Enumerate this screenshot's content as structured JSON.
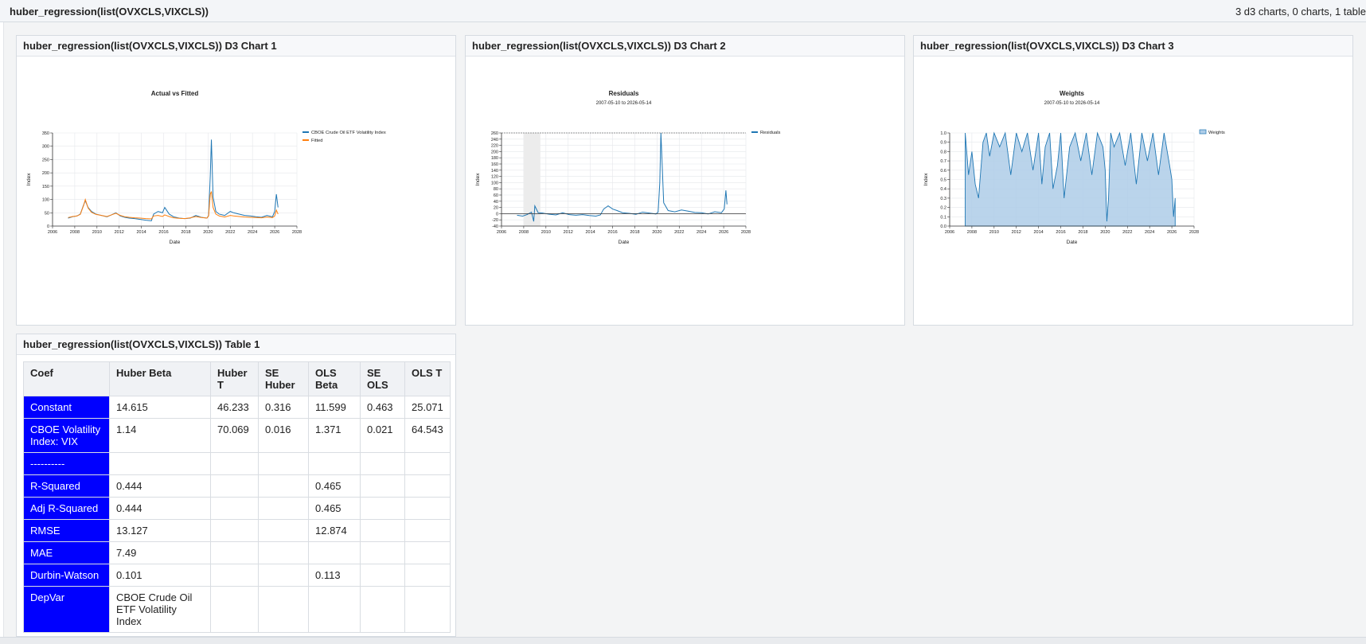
{
  "header": {
    "title": "huber_regression(list(OVXCLS,VIXCLS))",
    "summary": "3 d3 charts, 0 charts, 1 table"
  },
  "colors": {
    "series_blue": "#1f77b4",
    "series_orange": "#ff7f0e",
    "rowhead_blue": "#0000ff",
    "weights_fill": "#aecde8"
  },
  "panels": {
    "chart1_title": "huber_regression(list(OVXCLS,VIXCLS)) D3 Chart 1",
    "chart2_title": "huber_regression(list(OVXCLS,VIXCLS)) D3 Chart 2",
    "chart3_title": "huber_regression(list(OVXCLS,VIXCLS)) D3 Chart 3",
    "table_title": "huber_regression(list(OVXCLS,VIXCLS)) Table 1"
  },
  "chart_data": [
    {
      "type": "line",
      "title": "Actual vs Fitted",
      "subtitle": "",
      "xlabel": "Date",
      "ylabel": "Index",
      "xlim": [
        2006,
        2028
      ],
      "ylim": [
        0,
        350
      ],
      "xticks": [
        "2006",
        "2008",
        "2010",
        "2012",
        "2014",
        "2016",
        "2018",
        "2020",
        "2022",
        "2024",
        "2026",
        "2028"
      ],
      "yticks": [
        0,
        50,
        100,
        150,
        200,
        250,
        300,
        350
      ],
      "legend": "top-right",
      "grid": true,
      "x": [
        2007.4,
        2007.8,
        2008.2,
        2008.5,
        2008.8,
        2008.95,
        2009.2,
        2009.5,
        2009.9,
        2010.4,
        2010.9,
        2011.3,
        2011.7,
        2012.1,
        2012.5,
        2012.9,
        2013.4,
        2013.9,
        2014.4,
        2014.9,
        2015.1,
        2015.5,
        2015.9,
        2016.1,
        2016.5,
        2016.9,
        2017.4,
        2017.9,
        2018.4,
        2018.9,
        2019.4,
        2019.9,
        2020.05,
        2020.2,
        2020.3,
        2020.45,
        2020.7,
        2021.0,
        2021.5,
        2022.0,
        2022.3,
        2022.8,
        2023.3,
        2023.8,
        2024.3,
        2024.8,
        2025.3,
        2025.8,
        2026.0,
        2026.15,
        2026.3
      ],
      "series": [
        {
          "name": "CBOE Crude Oil ETF Volatility Index",
          "values": [
            30,
            35,
            38,
            45,
            80,
            95,
            70,
            55,
            45,
            40,
            35,
            42,
            50,
            38,
            33,
            30,
            28,
            25,
            22,
            20,
            45,
            55,
            50,
            70,
            45,
            35,
            30,
            28,
            30,
            40,
            33,
            30,
            40,
            190,
            325,
            110,
            55,
            45,
            40,
            55,
            50,
            45,
            40,
            38,
            35,
            33,
            40,
            35,
            55,
            120,
            70
          ]
        },
        {
          "name": "Fitted",
          "values": [
            32,
            36,
            38,
            44,
            78,
            100,
            68,
            52,
            44,
            40,
            36,
            42,
            48,
            40,
            35,
            33,
            31,
            30,
            28,
            27,
            38,
            40,
            36,
            42,
            36,
            31,
            29,
            28,
            31,
            36,
            32,
            30,
            38,
            120,
            130,
            70,
            45,
            38,
            34,
            40,
            38,
            36,
            34,
            33,
            32,
            31,
            34,
            32,
            38,
            60,
            45
          ]
        }
      ]
    },
    {
      "type": "line",
      "title": "Residuals",
      "subtitle": "2007-05-10 to 2026-05-14",
      "xlabel": "Date",
      "ylabel": "Index",
      "xlim": [
        2006,
        2028
      ],
      "ylim": [
        -40,
        260
      ],
      "xticks": [
        "2006",
        "2008",
        "2010",
        "2012",
        "2014",
        "2016",
        "2018",
        "2020",
        "2022",
        "2024",
        "2026",
        "2028"
      ],
      "yticks": [
        -40,
        -20,
        0,
        20,
        40,
        60,
        80,
        100,
        120,
        140,
        160,
        180,
        200,
        220,
        240,
        260
      ],
      "shaded_region": [
        2008.0,
        2009.5
      ],
      "legend": "top-right",
      "grid": true,
      "x": [
        2007.4,
        2007.9,
        2008.3,
        2008.7,
        2008.9,
        2009.0,
        2009.3,
        2009.7,
        2010.3,
        2010.9,
        2011.5,
        2012.1,
        2012.7,
        2013.3,
        2013.9,
        2014.5,
        2014.9,
        2015.2,
        2015.6,
        2016.0,
        2016.4,
        2016.9,
        2017.5,
        2018.1,
        2018.7,
        2019.3,
        2019.9,
        2020.1,
        2020.25,
        2020.35,
        2020.6,
        2021.0,
        2021.6,
        2022.2,
        2022.8,
        2023.4,
        2024.0,
        2024.6,
        2025.2,
        2025.8,
        2026.05,
        2026.2,
        2026.3
      ],
      "series": [
        {
          "name": "Residuals",
          "values": [
            -5,
            -8,
            -3,
            5,
            -25,
            25,
            3,
            2,
            -2,
            -4,
            3,
            -3,
            -5,
            -3,
            -6,
            -8,
            -4,
            15,
            25,
            15,
            10,
            3,
            1,
            -2,
            5,
            2,
            -1,
            5,
            100,
            260,
            35,
            10,
            6,
            12,
            8,
            4,
            3,
            -1,
            6,
            3,
            15,
            75,
            30
          ]
        }
      ]
    },
    {
      "type": "area",
      "title": "Weights",
      "subtitle": "2007-05-10 to 2026-05-14",
      "xlabel": "Date",
      "ylabel": "Index",
      "xlim": [
        2006,
        2028
      ],
      "ylim": [
        0,
        1
      ],
      "xticks": [
        "2006",
        "2008",
        "2010",
        "2012",
        "2014",
        "2016",
        "2018",
        "2020",
        "2022",
        "2024",
        "2026",
        "2028"
      ],
      "yticks": [
        "0.0",
        "0.1",
        "0.2",
        "0.3",
        "0.4",
        "0.5",
        "0.6",
        "0.7",
        "0.8",
        "0.9",
        "1.0"
      ],
      "legend": "top-right",
      "grid": true,
      "x": [
        2007.4,
        2007.7,
        2008.0,
        2008.3,
        2008.6,
        2008.8,
        2009.0,
        2009.3,
        2009.6,
        2010.0,
        2010.5,
        2011.0,
        2011.5,
        2012.0,
        2012.5,
        2013.0,
        2013.5,
        2014.0,
        2014.3,
        2014.6,
        2015.0,
        2015.3,
        2015.7,
        2016.0,
        2016.3,
        2016.8,
        2017.3,
        2017.8,
        2018.3,
        2018.8,
        2019.3,
        2019.8,
        2020.0,
        2020.15,
        2020.3,
        2020.5,
        2020.8,
        2021.3,
        2021.8,
        2022.3,
        2022.8,
        2023.3,
        2023.8,
        2024.3,
        2024.8,
        2025.3,
        2025.8,
        2026.0,
        2026.15,
        2026.3
      ],
      "series": [
        {
          "name": "Weights",
          "values": [
            1.0,
            0.55,
            0.8,
            0.45,
            0.3,
            0.6,
            0.9,
            1.0,
            0.75,
            1.0,
            0.85,
            1.0,
            0.55,
            1.0,
            0.8,
            1.0,
            0.6,
            1.0,
            0.45,
            0.85,
            1.0,
            0.4,
            0.65,
            1.0,
            0.3,
            0.85,
            1.0,
            0.7,
            1.0,
            0.55,
            1.0,
            0.85,
            0.6,
            0.05,
            0.3,
            1.0,
            0.85,
            1.0,
            0.65,
            1.0,
            0.45,
            1.0,
            0.7,
            1.0,
            0.55,
            1.0,
            0.65,
            0.5,
            0.1,
            0.3
          ]
        }
      ]
    }
  ],
  "table": {
    "columns": [
      "Coef",
      "Huber Beta",
      "Huber T",
      "SE Huber",
      "OLS Beta",
      "SE OLS",
      "OLS T"
    ],
    "rows": [
      [
        "Constant",
        "14.615",
        "46.233",
        "0.316",
        "11.599",
        "0.463",
        "25.071"
      ],
      [
        "CBOE Volatility Index: VIX",
        "1.14",
        "70.069",
        "0.016",
        "1.371",
        "0.021",
        "64.543"
      ],
      [
        "----------",
        "",
        "",
        "",
        "",
        "",
        ""
      ],
      [
        "R-Squared",
        "0.444",
        "",
        "",
        "0.465",
        "",
        ""
      ],
      [
        "Adj R-Squared",
        "0.444",
        "",
        "",
        "0.465",
        "",
        ""
      ],
      [
        "RMSE",
        "13.127",
        "",
        "",
        "12.874",
        "",
        ""
      ],
      [
        "MAE",
        "7.49",
        "",
        "",
        "",
        "",
        ""
      ],
      [
        "Durbin-Watson",
        "0.101",
        "",
        "",
        "0.113",
        "",
        ""
      ],
      [
        "DepVar",
        "CBOE Crude Oil ETF Volatility Index",
        "",
        "",
        "",
        "",
        ""
      ]
    ]
  }
}
